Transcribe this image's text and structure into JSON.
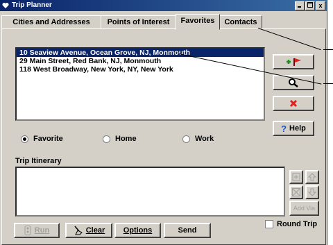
{
  "window": {
    "title": "Trip Planner",
    "close_glyph": "x"
  },
  "tabs": [
    "Cities and Addresses",
    "Points of Interest",
    "Favorites",
    "Contacts"
  ],
  "favorites": {
    "items": [
      "10 Seaview Avenue, Ocean Grove, NJ, Monmouth",
      "29 Main Street, Red Bank, NJ, Monmouth",
      "118 West Broadway, New York, NY, New York"
    ],
    "selected_index": 0
  },
  "radios": [
    {
      "label": "Favorite",
      "checked": true
    },
    {
      "label": "Home",
      "checked": false
    },
    {
      "label": "Work",
      "checked": false
    }
  ],
  "side_buttons": {
    "help_label": "Help"
  },
  "itinerary": {
    "label": "Trip Itinerary",
    "add_via_label": "Add Via"
  },
  "bottom_buttons": {
    "run_label": "Run",
    "clear_label": "Clear",
    "options_label": "Options",
    "send_label": "Send"
  },
  "round_trip": {
    "label": "Round Trip",
    "checked": false
  },
  "colors": {
    "selection": "#0a246a",
    "title_bar": "#0a246a",
    "face": "#d4d0c8"
  }
}
